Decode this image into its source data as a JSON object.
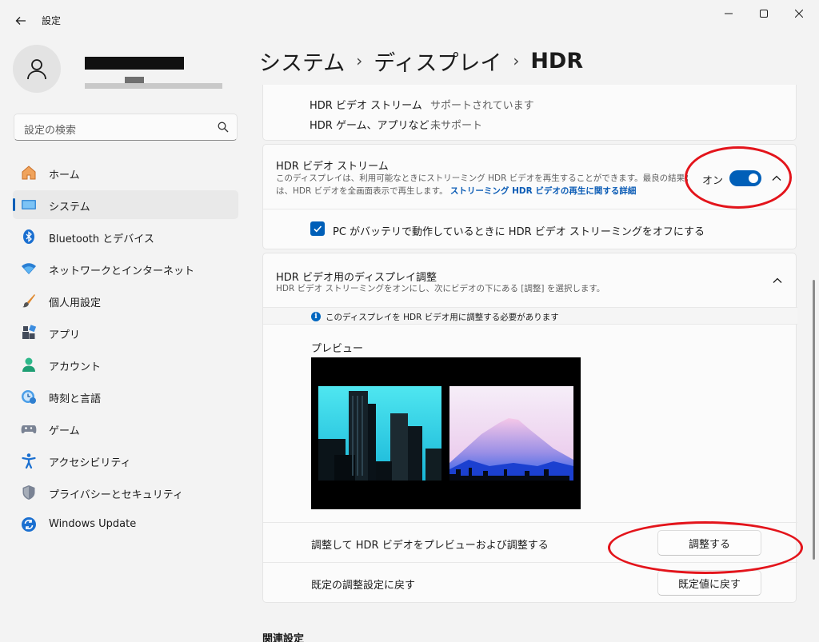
{
  "window": {
    "title": "設定",
    "minimize_glyph": "–",
    "maximize_glyph": "☐",
    "close_glyph": "✕"
  },
  "sidebar": {
    "search_placeholder": "設定の検索",
    "items": [
      {
        "label": "ホーム",
        "icon": "home-icon",
        "active": false
      },
      {
        "label": "システム",
        "icon": "system-icon",
        "active": true
      },
      {
        "label": "Bluetooth とデバイス",
        "icon": "bluetooth-icon",
        "active": false
      },
      {
        "label": "ネットワークとインターネット",
        "icon": "network-icon",
        "active": false
      },
      {
        "label": "個人用設定",
        "icon": "personalization-icon",
        "active": false
      },
      {
        "label": "アプリ",
        "icon": "apps-icon",
        "active": false
      },
      {
        "label": "アカウント",
        "icon": "account-icon",
        "active": false
      },
      {
        "label": "時刻と言語",
        "icon": "time-language-icon",
        "active": false
      },
      {
        "label": "ゲーム",
        "icon": "gaming-icon",
        "active": false
      },
      {
        "label": "アクセシビリティ",
        "icon": "accessibility-icon",
        "active": false
      },
      {
        "label": "プライバシーとセキュリティ",
        "icon": "privacy-shield-icon",
        "active": false
      },
      {
        "label": "Windows Update",
        "icon": "windows-update-icon",
        "active": false
      }
    ]
  },
  "breadcrumb": {
    "items": [
      "システム",
      "ディスプレイ",
      "HDR"
    ],
    "separator": "›"
  },
  "capabilities": {
    "rows": [
      {
        "label": "HDR ビデオ ストリーム",
        "value": "サポートされています"
      },
      {
        "label": "HDR ゲーム、アプリなど",
        "value": "未サポート"
      }
    ]
  },
  "hdr_stream": {
    "title": "HDR ビデオ ストリーム",
    "desc_line1": "このディスプレイは、利用可能なときにストリーミング HDR ビデオを再生することができます。最良の結果を得るに",
    "desc_line2": "は、HDR ビデオを全画面表示で再生します。",
    "link": "ストリーミング HDR ビデオの再生に関する詳細",
    "toggle_label": "オン",
    "toggle_on": true,
    "battery_option": "PC がバッテリで動作しているときに HDR ビデオ ストリーミングをオフにする",
    "battery_checked": true
  },
  "calibration": {
    "title": "HDR ビデオ用のディスプレイ調整",
    "desc": "HDR ビデオ ストリーミングをオンにし、次にビデオの下にある [調整] を選択します。",
    "info": "このディスプレイを HDR ビデオ用に調整する必要があります",
    "preview_label": "プレビュー",
    "adjust_label": "調整して HDR ビデオをプレビューおよび調整する",
    "adjust_button": "調整する",
    "reset_label": "既定の調整設定に戻す",
    "reset_button": "既定値に戻す"
  },
  "related_heading": "関連設定",
  "colors": {
    "accent": "#005fb8",
    "annotation": "#e3141b"
  }
}
